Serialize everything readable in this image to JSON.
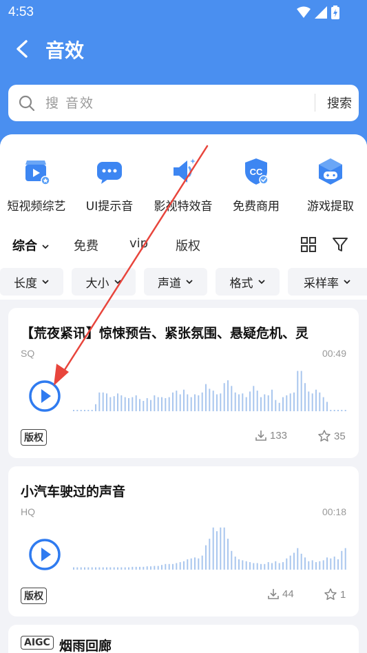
{
  "status_bar": {
    "time": "4:53"
  },
  "header": {
    "title": "音效"
  },
  "search": {
    "placeholder": "搜 音效",
    "button_label": "搜索"
  },
  "categories": [
    {
      "label": "短视频综艺",
      "icon": "clapperboard-icon"
    },
    {
      "label": "UI提示音",
      "icon": "chat-bubble-icon"
    },
    {
      "label": "影视特效音",
      "icon": "speaker-icon"
    },
    {
      "label": "免费商用",
      "icon": "cc-shield-icon"
    },
    {
      "label": "游戏提取",
      "icon": "game-cube-icon"
    }
  ],
  "tabs": [
    {
      "label": "综合",
      "active": true
    },
    {
      "label": "免费"
    },
    {
      "label": "vip"
    },
    {
      "label": "版权"
    }
  ],
  "filters": [
    "长度",
    "大小",
    "声道",
    "格式",
    "采样率"
  ],
  "cards": [
    {
      "title": "【荒夜紧讯】惊悚预告、紧张氛围、悬疑危机、灵",
      "quality": "SQ",
      "duration": "00:49",
      "badge": "版权",
      "downloads": "133",
      "favorites": "35",
      "waveform": [
        0.03,
        0.03,
        0.03,
        0.03,
        0.03,
        0.03,
        0.15,
        0.4,
        0.4,
        0.38,
        0.3,
        0.32,
        0.38,
        0.34,
        0.3,
        0.28,
        0.3,
        0.34,
        0.26,
        0.22,
        0.28,
        0.24,
        0.34,
        0.3,
        0.3,
        0.28,
        0.3,
        0.4,
        0.44,
        0.36,
        0.46,
        0.36,
        0.3,
        0.36,
        0.34,
        0.4,
        0.58,
        0.48,
        0.44,
        0.36,
        0.38,
        0.6,
        0.66,
        0.54,
        0.4,
        0.36,
        0.38,
        0.3,
        0.42,
        0.54,
        0.44,
        0.3,
        0.36,
        0.34,
        0.46,
        0.24,
        0.18,
        0.3,
        0.34,
        0.38,
        0.4,
        0.86,
        0.86,
        0.6,
        0.42,
        0.38,
        0.46,
        0.4,
        0.3,
        0.2,
        0.03,
        0.03,
        0.03,
        0.03,
        0.03
      ]
    },
    {
      "title": "小汽车驶过的声音",
      "quality": "HQ",
      "duration": "00:18",
      "badge": "版权",
      "downloads": "44",
      "favorites": "1",
      "waveform": [
        0.05,
        0.05,
        0.05,
        0.05,
        0.05,
        0.05,
        0.05,
        0.05,
        0.05,
        0.05,
        0.05,
        0.05,
        0.05,
        0.05,
        0.05,
        0.05,
        0.06,
        0.06,
        0.06,
        0.06,
        0.07,
        0.07,
        0.08,
        0.08,
        0.1,
        0.12,
        0.12,
        0.12,
        0.14,
        0.16,
        0.18,
        0.22,
        0.24,
        0.26,
        0.24,
        0.3,
        0.52,
        0.66,
        0.9,
        0.82,
        0.9,
        0.9,
        0.66,
        0.4,
        0.28,
        0.22,
        0.2,
        0.18,
        0.16,
        0.14,
        0.14,
        0.12,
        0.12,
        0.16,
        0.14,
        0.18,
        0.14,
        0.16,
        0.24,
        0.3,
        0.36,
        0.46,
        0.34,
        0.26,
        0.18,
        0.2,
        0.16,
        0.18,
        0.2,
        0.26,
        0.24,
        0.28,
        0.22,
        0.4,
        0.46
      ]
    },
    {
      "title": "烟雨回廊",
      "badge": "AIGC"
    }
  ],
  "colors": {
    "brand": "#4a8ff0",
    "accent": "#2f7bf0",
    "annotation_arrow": "#e8453c"
  }
}
